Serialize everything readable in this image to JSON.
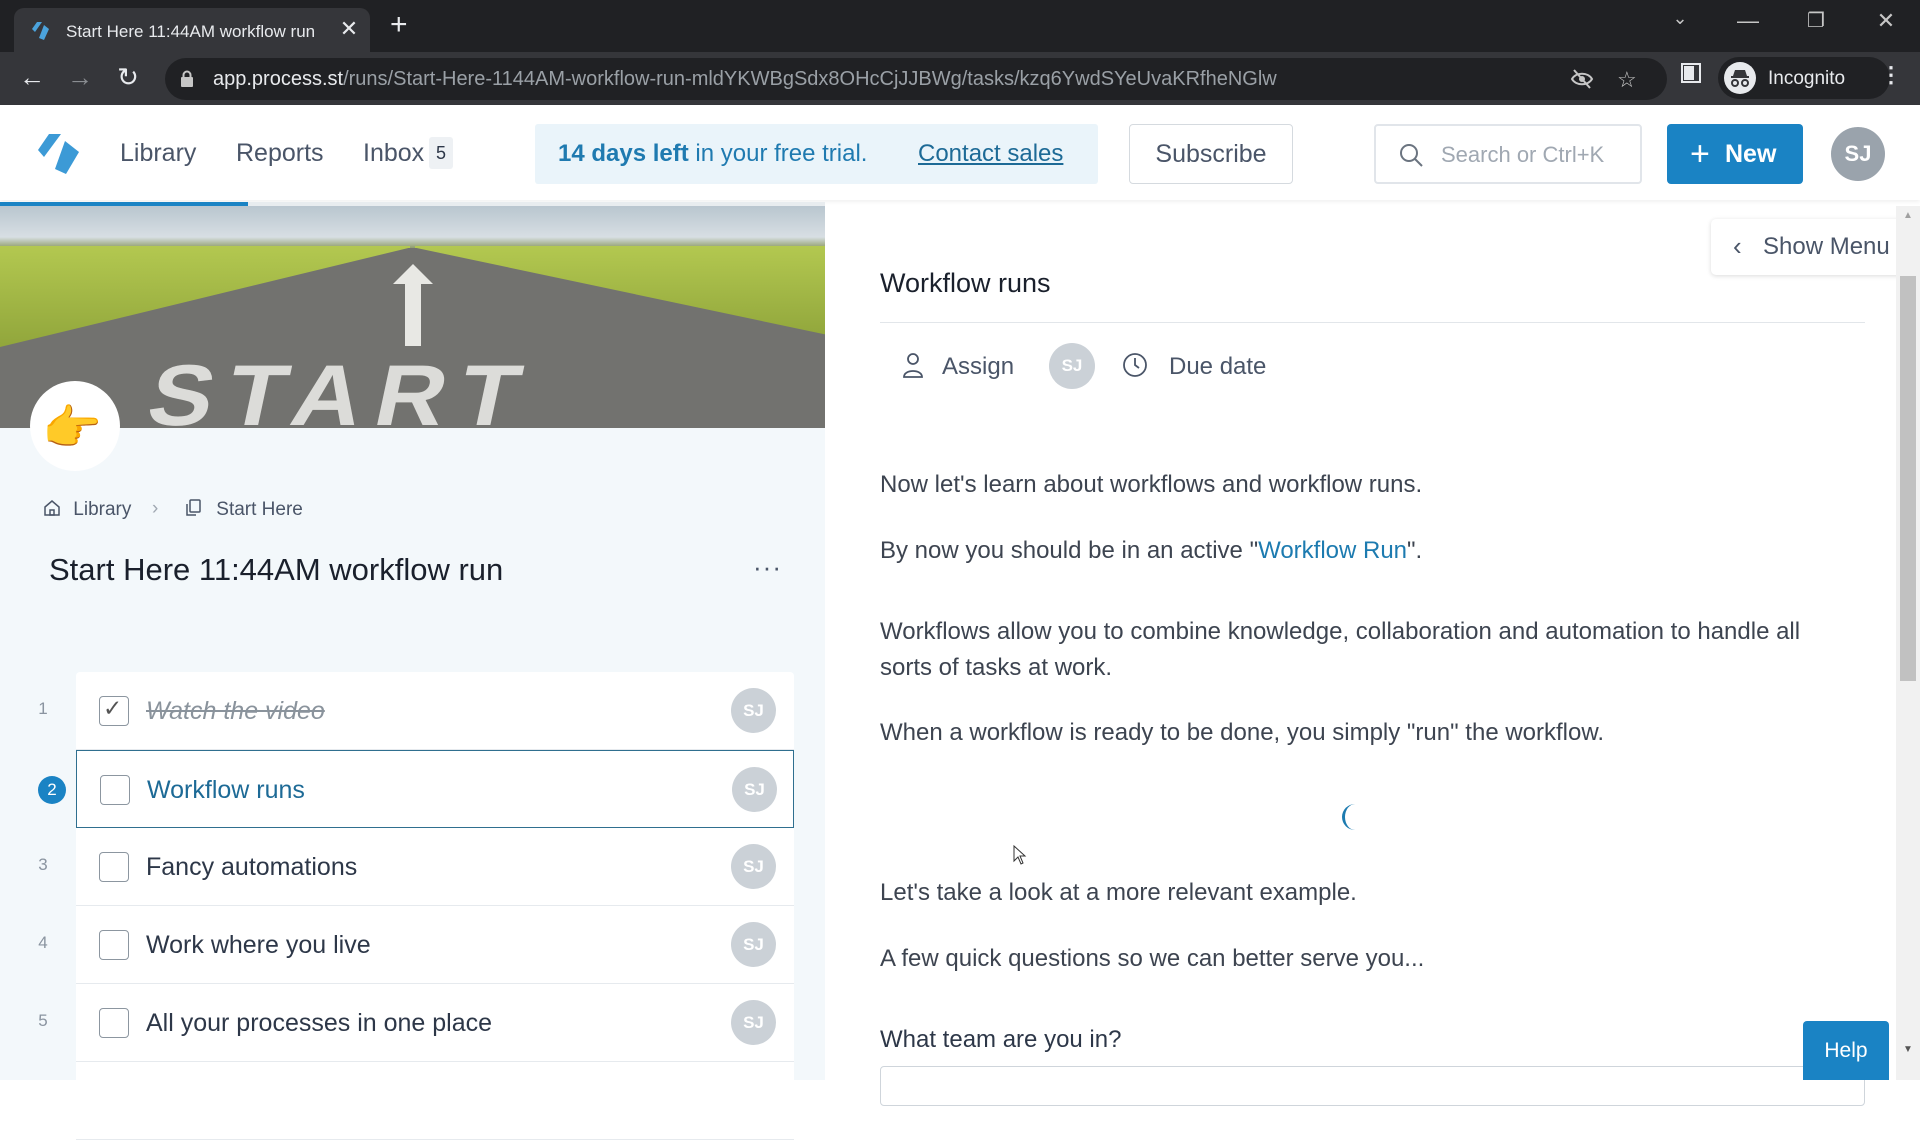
{
  "browser": {
    "tab_title": "Start Here 11:44AM workflow run",
    "new_tab_label": "+",
    "url_host": "app.process.st",
    "url_path": "/runs/Start-Here-1144AM-workflow-run-mldYKWBgSdx8OHcCjJJBWg/tasks/kzq6YwdSYeUvaKRfheNGlw",
    "profile_label": "Incognito",
    "icons": [
      "back-arrow",
      "forward-arrow",
      "reload",
      "lock",
      "eye-off",
      "star",
      "side-panel",
      "incognito",
      "kebab-menu"
    ]
  },
  "header": {
    "nav": [
      {
        "label": "Library"
      },
      {
        "label": "Reports"
      },
      {
        "label": "Inbox"
      }
    ],
    "inbox_count": "5",
    "trial": {
      "bold": "14 days left",
      "rest": " in your free trial.",
      "link": "Contact sales"
    },
    "subscribe_label": "Subscribe",
    "search_placeholder": "Search or Ctrl+K",
    "new_label": "New",
    "avatar_initials": "SJ",
    "accent_color": "#1a83c4"
  },
  "run": {
    "progress_percent": 30,
    "emoji": "👉",
    "breadcrumb": [
      {
        "label": "Library",
        "icon": "home-icon"
      },
      {
        "label": "Start Here",
        "icon": "copy-icon"
      }
    ],
    "title": "Start Here 11:44AM workflow run",
    "more_label": "···",
    "tasks": [
      {
        "num": "1",
        "label": "Watch the video",
        "done": true,
        "assignee": "SJ"
      },
      {
        "num": "2",
        "label": "Workflow runs",
        "done": false,
        "current": true,
        "assignee": "SJ"
      },
      {
        "num": "3",
        "label": "Fancy automations",
        "done": false,
        "assignee": "SJ"
      },
      {
        "num": "4",
        "label": "Work where you live",
        "done": false,
        "assignee": "SJ"
      },
      {
        "num": "5",
        "label": "All your processes in one place",
        "done": false,
        "assignee": "SJ"
      }
    ]
  },
  "task_detail": {
    "title": "Workflow runs",
    "assign_label": "Assign",
    "assignee_initials": "SJ",
    "due_date_label": "Due date",
    "paragraphs": {
      "p1": "Now let's learn about workflows and workflow runs.",
      "p2_before": "By now you should be in an active \"",
      "p2_link": "Workflow Run",
      "p2_after": "\".",
      "p3": "Workflows allow you to combine knowledge, collaboration and automation to handle all sorts of tasks at work.",
      "p4": "When a workflow is ready to be done, you simply \"run\" the workflow.",
      "p5": "Let's take a look at a more relevant example.",
      "p6": "A few quick questions so we can better serve you..."
    },
    "question": "What team are you in?"
  },
  "show_menu_label": "Show Menu",
  "help_label": "Help"
}
